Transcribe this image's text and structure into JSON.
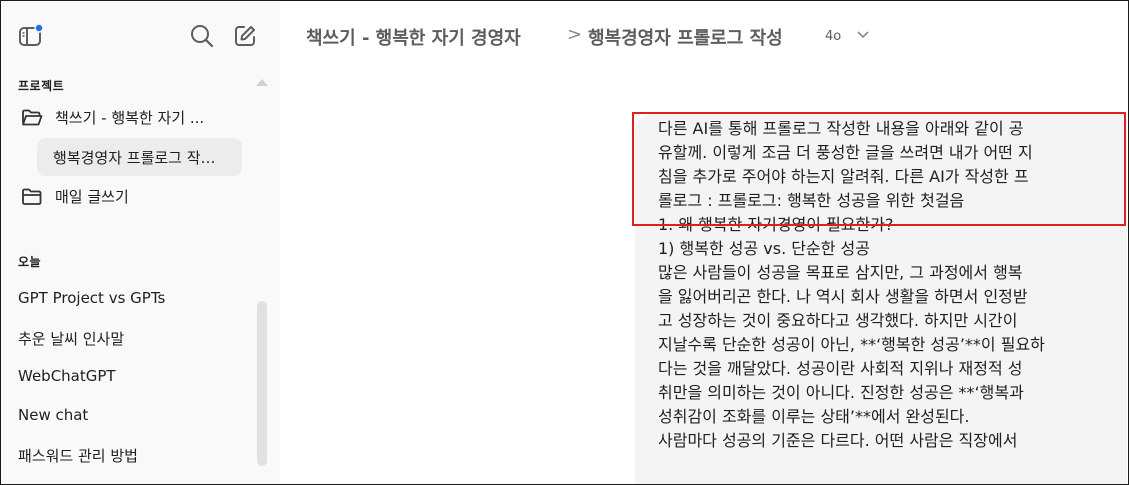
{
  "sidebar": {
    "projects_heading": "프로젝트",
    "projects": [
      {
        "label": "책쓰기 - 행복한 자기 ..."
      },
      {
        "label": "행복경영자 프롤로그 작…",
        "selected": true
      },
      {
        "label": "매일 글쓰기"
      }
    ],
    "today_heading": "오늘",
    "chats": [
      {
        "label": "GPT Project vs GPTs"
      },
      {
        "label": "추운 날씨 인사말"
      },
      {
        "label": "WebChatGPT"
      },
      {
        "label": "New chat"
      },
      {
        "label": "패스워드 관리 방법"
      }
    ],
    "icons": {
      "toggle": "sidebar-toggle-icon",
      "search": "search-icon",
      "new_chat": "edit-icon"
    },
    "notification_dot_color": "#1a73e8"
  },
  "header": {
    "project": "책쓰기 - 행복한 자기 경영자",
    "separator": ">",
    "chat_title": "행복경영자 프롤로그 작성",
    "model": "4o"
  },
  "message": {
    "lines": [
      "다른 AI를 통해 프롤로그 작성한 내용을 아래와 같이 공",
      "유할께. 이렇게 조금 더 풍성한 글을 쓰려면 내가 어떤 지",
      "침을 추가로 주어야 하는지 알려줘. 다른 AI가 작성한 프",
      "롤로그 : 프롤로그: 행복한 성공을 위한 첫걸음",
      "1. 왜 행복한 자기경영이 필요한가?",
      "1) 행복한 성공 vs. 단순한 성공",
      "많은 사람들이 성공을 목표로 삼지만, 그 과정에서 행복",
      "을 잃어버리곤 한다. 나 역시 회사 생활을 하면서 인정받",
      "고 성장하는 것이 중요하다고 생각했다. 하지만 시간이",
      "지날수록 단순한 성공이 아닌, **‘행복한 성공’**이 필요하",
      "다는 것을 깨달았다. 성공이란 사회적 지위나 재정적 성",
      "취만을 의미하는 것이 아니다. 진정한 성공은 **‘행복과",
      "성취감이 조화를 이루는 상태’**에서 완성된다.",
      "사람마다 성공의 기준은 다르다. 어떤 사람은 직장에서"
    ],
    "highlight_color": "#e02020"
  }
}
